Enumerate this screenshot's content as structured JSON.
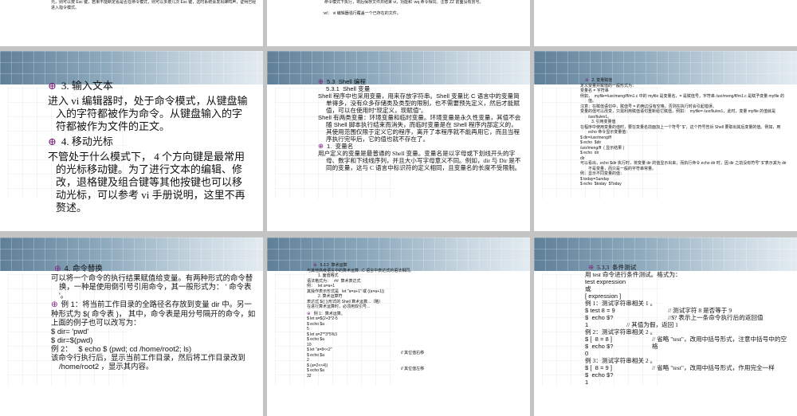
{
  "slides": {
    "s1": [
      "元，则可以按 Esc 键，若果不能断定看是否在命令模式，则可以多按几次 Esc 键，这时系统会发出蜂鸣声，证明已经进入指令模式。"
    ],
    "s2": [
      "命令模式下执行，将后保存文件并结束 vi，功能和 :wq 命令相同。注意 ZZ 前面没有冒号。",
      ":w!： vi 编辑器强行覆盖一个已存在的文件。"
    ],
    "s4": [
      "3. 输入文本",
      "进入 vi 编辑器时，处于命令模式，从键盘输入的字符都被作为命令。从键盘输入的字符都被作为文件的正文。",
      "4. 移动光标",
      "不管处于什么模式下， 4 个方向键是最常用的光标移动键。为了进行文本的编辑、修改，退格键及组合键等其他按键也可以移动光标，可以参考 vi 手册说明，这里不再赘述。"
    ],
    "s5": [
      "5.3  Shell 编程",
      "5.3.1  Shell 变量",
      "Shell 程序中也采用变量，用来存放字符串。Shell 变量比 C 语言中的变量简单得多，没有众多存储类及类型的限制，也不需要预先定义，然后才能赋值，可以在使用时“现定义，现赋值”。",
      "Shell 有两类变量：环境变量和临时变量。环境变量是永久性变量，其值不会随 Shell 脚本执行结束而消失，而临时变量是在 Shell 程序内部定义的，其使用范围仅限于定义它的程序，离开了本程序就不能再用它，而且当程序执行完毕后，它的值也就不存在了。",
      "1.  变量名",
      "用户定义的变量是最普通的 Shell 变量。变量名是以字母或下划线开头的字母、数字和下线线序列，并且大小写字母意义不同。例如，dir 与 Dir 是不同的变量，这与 C 语言中标识符的定义相同，且变量名的长度不受限制。"
    ],
    "s6": [
      "2. 变量赋值",
      "定义变量并赋值的一般形式为：",
      "变量名 = 字符串",
      "例如，  myfile=/usr/meng/ff/m1.c 中的 myfile 是变量名，= 是赋值号，字符串 /usr/meng/ff/m1.c 是赋予变量 myfile 的值。",
      "注意：在赋值语句中，赋值号 = 的两边没有空格，否则在执行时会引起错误。",
      "变量的值可以改变，只需利用赋值语句重新给它赋值，例如：  myfile= /usr/liu/ex1，此时，变量 myfile 的值就是 /usr/liu/ex1。",
      "3. 引用变量值",
      "在程序中使用变量的值时，要在变量名前面加上一个符号“ $”，这个符号告诉 Shell 要取出其后变量的值。例如，用 echo 命令显示变量值：",
      "$ dir=/usr/meng/ff",
      "$ echo  $dir",
      "/usr/meng/ff  ( 显示结果 )",
      "$ echo  dir",
      "dir",
      "可以看出，echo $dir 执行时，将变量 dir 的值显示出来，而执行命令 echo dir 时，因 dir 之前没有符号“ $”表示其为 dir 不是变量，而只是一般的字符串常量。",
      "例：显示不同变量的值：",
      "$ today=Sunday",
      "$ echo  $today  $Today"
    ],
    "s7": [
      "4. 命令替换",
      "可以将一个命令的执行结果赋值给变量。有两种形式的命令替换，一种是使用倒引号引用命令，其一般形式为： ' 命令表 '。",
      "例 1：将当前工作目录的全路径名存放到变量 dir 中。另一种形式为 $( 命令表 )， 其中，命令表是用分号隔开的命令，如上面的例子也可以改写为：",
      "$ dir= 'pwd'",
      "$ dir=$(pwd)",
      "例 2：   $ echo $ (pwd; cd /home/root2; ls)",
      "该命令行执行后，显示当前工作目录，然后将工作目录改到 /home/root2 ，显示其内容。"
    ],
    "s8": [
      "5.3.2  算术运算",
      "与其他高级语言中的算术运算...C 语言中表达式的语法相同。",
      "1. 面值格式",
      "语法格式为：   ##  算术表达式",
      "例：   let a=a+1",
      "其操作表示形式是   let \"a=a+1\" 或 ((a=a+1))",
      "2. 算术运算符",
      "表达式 $(( ))形式的 Shell 算术运算...（略）",
      "在进行算术运算时，必须用双引号...",
      "例 1：算术运算。",
      "$ let a=$(2+3*2-5",
      "$ echo $a",
      "5",
      "$ let a=2**3*5%3",
      "$ echo $a",
      "10",
      "$ let \"a=8<<2\"",
      "$ echo $a",
      "2",
      "$ (a=2<<4))",
      "$ echo $a",
      "32",
      "// 其位值右移",
      "// 其位值左移"
    ],
    "s9": [
      "5.3.3  条件测试",
      "用 test 命令进行条件测试。格式为：",
      "test expression",
      "或",
      "[ expression ]",
      "例 1：测试字符串相关 1 。",
      "$ test 8 = 9",
      "$  echo $?",
      "1",
      "例 2：测试字符串相关 2 。",
      "$ [  8 = 8 ]",
      "$  echo $?",
      "0",
      "例 3：测试字符串相关 2 。",
      "$ [  8 = 9 ]",
      "$  echo $?",
      "1",
      "// 测试字符 8 是否等于 9",
      "//$? 表示上一条命令执行后的返回值",
      "// 其值为假，返回 1",
      "// 省略 \"test\"，改用中括号形式，注意中括号中的空格",
      "// 省略 \"test\"，改用中括号形式，作用完全一样"
    ]
  }
}
